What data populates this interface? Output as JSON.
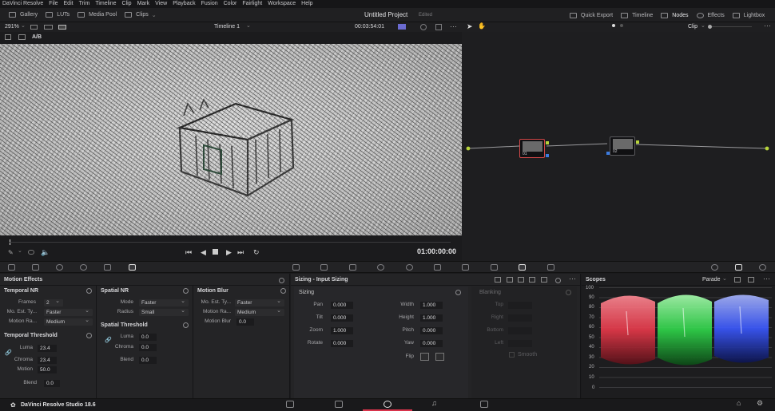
{
  "menu": [
    "DaVinci Resolve",
    "File",
    "Edit",
    "Trim",
    "Timeline",
    "Clip",
    "Mark",
    "View",
    "Playback",
    "Fusion",
    "Color",
    "Fairlight",
    "Workspace",
    "Help"
  ],
  "toolbar": {
    "left": [
      "Gallery",
      "LUTs",
      "Media Pool",
      "Clips"
    ],
    "project_title": "Untitled Project",
    "project_status": "Edited",
    "right": [
      "Quick Export",
      "Timeline",
      "Nodes",
      "Effects",
      "Lightbox"
    ]
  },
  "viewer": {
    "zoom": "291%",
    "timeline": "Timeline 1",
    "timecode": "00:03:54:01",
    "ab": "A/B",
    "playhead_timecode": "01:00:00:00",
    "clip_mode": "Clip"
  },
  "nodes": [
    {
      "label": "01"
    },
    {
      "label": "02"
    }
  ],
  "motion_effects": {
    "title": "Motion Effects",
    "temporal_nr": {
      "title": "Temporal NR",
      "frames_label": "Frames",
      "frames": "2",
      "mo_est_label": "Mo. Est. Ty...",
      "mo_est": "Faster",
      "motion_range_label": "Motion Ra...",
      "motion_range": "Medium"
    },
    "temporal_threshold": {
      "title": "Temporal Threshold",
      "luma_label": "Luma",
      "luma": "23.4",
      "chroma_label": "Chroma",
      "chroma": "23.4",
      "motion_label": "Motion",
      "motion": "50.0",
      "blend_label": "Blend",
      "blend": "0.0"
    },
    "spatial_nr": {
      "title": "Spatial NR",
      "mode_label": "Mode",
      "mode": "Faster",
      "radius_label": "Radius",
      "radius": "Small"
    },
    "spatial_threshold": {
      "title": "Spatial Threshold",
      "luma_label": "Luma",
      "luma": "0.0",
      "chroma_label": "Chroma",
      "chroma": "0.0",
      "blend_label": "Blend",
      "blend": "0.0"
    },
    "motion_blur": {
      "title": "Motion Blur",
      "mo_est_label": "Mo. Est. Ty...",
      "mo_est": "Faster",
      "motion_range_label": "Motion Ra...",
      "motion_range": "Medium",
      "motion_blur_label": "Motion Blur",
      "motion_blur": "0.0"
    }
  },
  "sizing": {
    "title": "Sizing - Input Sizing",
    "section": "Sizing",
    "pan_label": "Pan",
    "pan": "0.000",
    "tilt_label": "Tilt",
    "tilt": "0.000",
    "zoom_label": "Zoom",
    "zoom": "1.000",
    "rotate_label": "Rotate",
    "rotate": "0.000",
    "width_label": "Width",
    "width": "1.000",
    "height_label": "Height",
    "height": "1.000",
    "pitch_label": "Pitch",
    "pitch": "0.000",
    "yaw_label": "Yaw",
    "yaw": "0.000",
    "flip_label": "Flip"
  },
  "blanking": {
    "title": "Blanking",
    "top": "Top",
    "right": "Right",
    "bottom": "Bottom",
    "left": "Left",
    "smooth": "Smooth"
  },
  "scopes": {
    "title": "Scopes",
    "mode": "Parade",
    "axis": [
      "100",
      "90",
      "80",
      "70",
      "60",
      "50",
      "40",
      "30",
      "20",
      "10",
      "0"
    ],
    "colors": {
      "red": "#e8394a",
      "green": "#2fd64a",
      "blue": "#3a58ff"
    }
  },
  "footer": {
    "app_name": "DaVinci Resolve Studio 18.6"
  }
}
